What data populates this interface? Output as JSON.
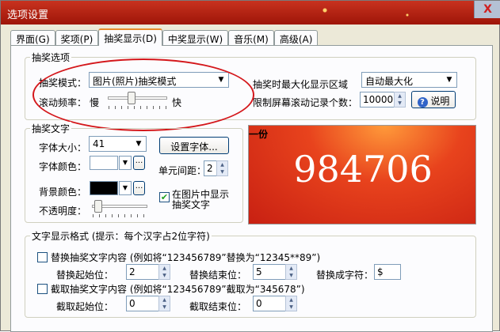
{
  "window": {
    "title": "选项设置",
    "close": "X"
  },
  "tabs": [
    "界面(G)",
    "奖项(P)",
    "抽奖显示(D)",
    "中奖显示(W)",
    "音乐(M)",
    "高级(A)"
  ],
  "draw_options": {
    "legend": "抽奖选项",
    "mode_label": "抽奖模式：",
    "mode_value": "图片(照片)抽奖模式",
    "speed_label": "滚动频率：",
    "speed_slow": "慢",
    "speed_fast": "快",
    "speed_level": 0.35,
    "maximize_label": "抽奖时最大化显示区域",
    "maximize_value": "自动最大化",
    "limit_label": "限制屏幕滚动记录个数：",
    "limit_value": "10000",
    "help_button": "说明"
  },
  "draw_text": {
    "legend": "抽奖文字",
    "size_label": "字体大小：",
    "size_value": "41",
    "set_font_button": "设置字体...",
    "color_label": "字体颜色：",
    "spacing_label": "单元间距：",
    "spacing_value": "2",
    "bg_color_label": "背景颜色：",
    "opacity_label": "不透明度：",
    "opacity_level": 0.05,
    "show_in_image_label": "在图片中显示抽奖文字",
    "show_in_image_checked": true,
    "more": "..."
  },
  "preview": {
    "label": "一份",
    "number": "984706"
  },
  "text_format": {
    "legend": "文字显示格式 (提示：每个汉字占2位字符)",
    "replace_label": "替换抽奖文字内容 (例如将“123456789”替换为“12345**89”)",
    "replace_start_label": "替换起始位：",
    "replace_start_value": "2",
    "replace_end_label": "替换结束位：",
    "replace_end_value": "5",
    "replace_with_label": "替换成字符：",
    "replace_with_value": "$",
    "cut_label": "截取抽奖文字内容 (例如将“123456789”截取为“345678”)",
    "cut_start_label": "截取起始位：",
    "cut_start_value": "0",
    "cut_end_label": "截取结束位：",
    "cut_end_value": "0"
  },
  "colors": {
    "title_bar": "#b8200e",
    "annotation": "#d4171b",
    "tab_highlight": "#e68b2c"
  }
}
